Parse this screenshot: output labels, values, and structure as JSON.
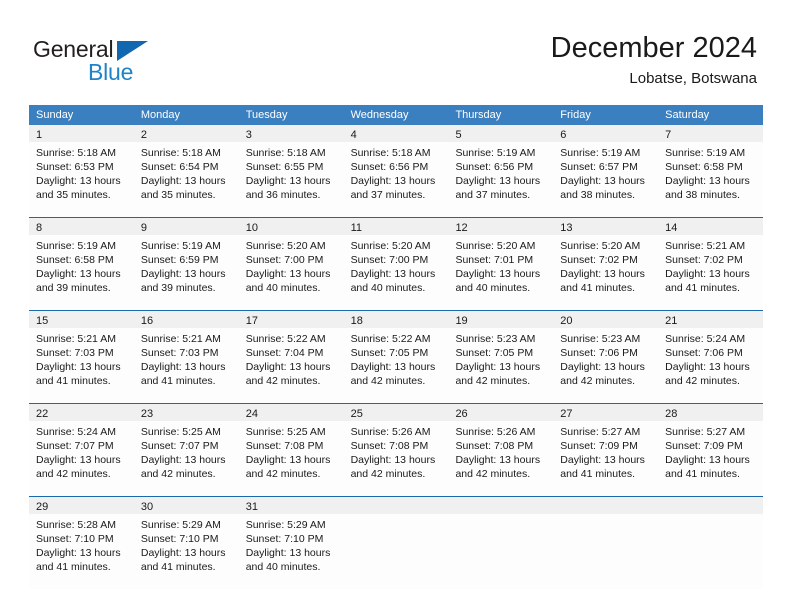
{
  "brand": {
    "name_part1": "General",
    "name_part2": "Blue",
    "triangle_icon": "triangle-icon",
    "colors": {
      "dark": "#231f20",
      "blue": "#1e83c9",
      "triangle": "#1267b1"
    }
  },
  "header": {
    "title": "December 2024",
    "subtitle": "Lobatse, Botswana"
  },
  "theme": {
    "header_row_bg": "#3a7fc0",
    "header_row_text": "#ffffff",
    "week_separator": "#1b69ab",
    "day_number_strip_bg": "#f0f0f0",
    "cell_bg": "#fdfdfd",
    "text": "#1a1a1a"
  },
  "weekdays": [
    "Sunday",
    "Monday",
    "Tuesday",
    "Wednesday",
    "Thursday",
    "Friday",
    "Saturday"
  ],
  "weeks": [
    [
      {
        "day": "1",
        "l1": "Sunrise: 5:18 AM",
        "l2": "Sunset: 6:53 PM",
        "l3": "Daylight: 13 hours",
        "l4": "and 35 minutes."
      },
      {
        "day": "2",
        "l1": "Sunrise: 5:18 AM",
        "l2": "Sunset: 6:54 PM",
        "l3": "Daylight: 13 hours",
        "l4": "and 35 minutes."
      },
      {
        "day": "3",
        "l1": "Sunrise: 5:18 AM",
        "l2": "Sunset: 6:55 PM",
        "l3": "Daylight: 13 hours",
        "l4": "and 36 minutes."
      },
      {
        "day": "4",
        "l1": "Sunrise: 5:18 AM",
        "l2": "Sunset: 6:56 PM",
        "l3": "Daylight: 13 hours",
        "l4": "and 37 minutes."
      },
      {
        "day": "5",
        "l1": "Sunrise: 5:19 AM",
        "l2": "Sunset: 6:56 PM",
        "l3": "Daylight: 13 hours",
        "l4": "and 37 minutes."
      },
      {
        "day": "6",
        "l1": "Sunrise: 5:19 AM",
        "l2": "Sunset: 6:57 PM",
        "l3": "Daylight: 13 hours",
        "l4": "and 38 minutes."
      },
      {
        "day": "7",
        "l1": "Sunrise: 5:19 AM",
        "l2": "Sunset: 6:58 PM",
        "l3": "Daylight: 13 hours",
        "l4": "and 38 minutes."
      }
    ],
    [
      {
        "day": "8",
        "l1": "Sunrise: 5:19 AM",
        "l2": "Sunset: 6:58 PM",
        "l3": "Daylight: 13 hours",
        "l4": "and 39 minutes."
      },
      {
        "day": "9",
        "l1": "Sunrise: 5:19 AM",
        "l2": "Sunset: 6:59 PM",
        "l3": "Daylight: 13 hours",
        "l4": "and 39 minutes."
      },
      {
        "day": "10",
        "l1": "Sunrise: 5:20 AM",
        "l2": "Sunset: 7:00 PM",
        "l3": "Daylight: 13 hours",
        "l4": "and 40 minutes."
      },
      {
        "day": "11",
        "l1": "Sunrise: 5:20 AM",
        "l2": "Sunset: 7:00 PM",
        "l3": "Daylight: 13 hours",
        "l4": "and 40 minutes."
      },
      {
        "day": "12",
        "l1": "Sunrise: 5:20 AM",
        "l2": "Sunset: 7:01 PM",
        "l3": "Daylight: 13 hours",
        "l4": "and 40 minutes."
      },
      {
        "day": "13",
        "l1": "Sunrise: 5:20 AM",
        "l2": "Sunset: 7:02 PM",
        "l3": "Daylight: 13 hours",
        "l4": "and 41 minutes."
      },
      {
        "day": "14",
        "l1": "Sunrise: 5:21 AM",
        "l2": "Sunset: 7:02 PM",
        "l3": "Daylight: 13 hours",
        "l4": "and 41 minutes."
      }
    ],
    [
      {
        "day": "15",
        "l1": "Sunrise: 5:21 AM",
        "l2": "Sunset: 7:03 PM",
        "l3": "Daylight: 13 hours",
        "l4": "and 41 minutes."
      },
      {
        "day": "16",
        "l1": "Sunrise: 5:21 AM",
        "l2": "Sunset: 7:03 PM",
        "l3": "Daylight: 13 hours",
        "l4": "and 41 minutes."
      },
      {
        "day": "17",
        "l1": "Sunrise: 5:22 AM",
        "l2": "Sunset: 7:04 PM",
        "l3": "Daylight: 13 hours",
        "l4": "and 42 minutes."
      },
      {
        "day": "18",
        "l1": "Sunrise: 5:22 AM",
        "l2": "Sunset: 7:05 PM",
        "l3": "Daylight: 13 hours",
        "l4": "and 42 minutes."
      },
      {
        "day": "19",
        "l1": "Sunrise: 5:23 AM",
        "l2": "Sunset: 7:05 PM",
        "l3": "Daylight: 13 hours",
        "l4": "and 42 minutes."
      },
      {
        "day": "20",
        "l1": "Sunrise: 5:23 AM",
        "l2": "Sunset: 7:06 PM",
        "l3": "Daylight: 13 hours",
        "l4": "and 42 minutes."
      },
      {
        "day": "21",
        "l1": "Sunrise: 5:24 AM",
        "l2": "Sunset: 7:06 PM",
        "l3": "Daylight: 13 hours",
        "l4": "and 42 minutes."
      }
    ],
    [
      {
        "day": "22",
        "l1": "Sunrise: 5:24 AM",
        "l2": "Sunset: 7:07 PM",
        "l3": "Daylight: 13 hours",
        "l4": "and 42 minutes."
      },
      {
        "day": "23",
        "l1": "Sunrise: 5:25 AM",
        "l2": "Sunset: 7:07 PM",
        "l3": "Daylight: 13 hours",
        "l4": "and 42 minutes."
      },
      {
        "day": "24",
        "l1": "Sunrise: 5:25 AM",
        "l2": "Sunset: 7:08 PM",
        "l3": "Daylight: 13 hours",
        "l4": "and 42 minutes."
      },
      {
        "day": "25",
        "l1": "Sunrise: 5:26 AM",
        "l2": "Sunset: 7:08 PM",
        "l3": "Daylight: 13 hours",
        "l4": "and 42 minutes."
      },
      {
        "day": "26",
        "l1": "Sunrise: 5:26 AM",
        "l2": "Sunset: 7:08 PM",
        "l3": "Daylight: 13 hours",
        "l4": "and 42 minutes."
      },
      {
        "day": "27",
        "l1": "Sunrise: 5:27 AM",
        "l2": "Sunset: 7:09 PM",
        "l3": "Daylight: 13 hours",
        "l4": "and 41 minutes."
      },
      {
        "day": "28",
        "l1": "Sunrise: 5:27 AM",
        "l2": "Sunset: 7:09 PM",
        "l3": "Daylight: 13 hours",
        "l4": "and 41 minutes."
      }
    ],
    [
      {
        "day": "29",
        "l1": "Sunrise: 5:28 AM",
        "l2": "Sunset: 7:10 PM",
        "l3": "Daylight: 13 hours",
        "l4": "and 41 minutes."
      },
      {
        "day": "30",
        "l1": "Sunrise: 5:29 AM",
        "l2": "Sunset: 7:10 PM",
        "l3": "Daylight: 13 hours",
        "l4": "and 41 minutes."
      },
      {
        "day": "31",
        "l1": "Sunrise: 5:29 AM",
        "l2": "Sunset: 7:10 PM",
        "l3": "Daylight: 13 hours",
        "l4": "and 40 minutes."
      },
      {
        "day": "",
        "l1": "",
        "l2": "",
        "l3": "",
        "l4": ""
      },
      {
        "day": "",
        "l1": "",
        "l2": "",
        "l3": "",
        "l4": ""
      },
      {
        "day": "",
        "l1": "",
        "l2": "",
        "l3": "",
        "l4": ""
      },
      {
        "day": "",
        "l1": "",
        "l2": "",
        "l3": "",
        "l4": ""
      }
    ]
  ]
}
